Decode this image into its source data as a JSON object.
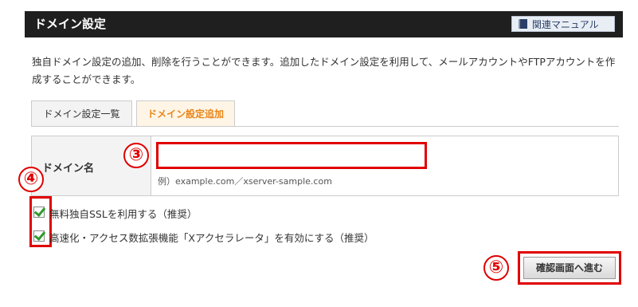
{
  "header": {
    "title": "ドメイン設定",
    "manual_button": "関連マニュアル"
  },
  "description": "独自ドメイン設定の追加、削除を行うことができます。追加したドメイン設定を利用して、メールアカウントやFTPアカウントを作成することができます。",
  "tabs": [
    {
      "label": "ドメイン設定一覧",
      "active": false
    },
    {
      "label": "ドメイン設定追加",
      "active": true
    }
  ],
  "form": {
    "domain_label": "ドメイン名",
    "domain_value": "",
    "domain_hint": "例）example.com／xserver-sample.com"
  },
  "options": [
    {
      "label": "無料独自SSLを利用する（推奨）",
      "checked": true
    },
    {
      "label": "高速化・アクセス数拡張機能「Xアクセラレータ」を有効にする（推奨）",
      "checked": true
    }
  ],
  "submit": {
    "label": "確認画面へ進む"
  },
  "annotations": {
    "n3": "③",
    "n4": "④",
    "n5": "⑤"
  },
  "colors": {
    "header_bg": "#1f1f1f",
    "active_tab": "#e8861a",
    "highlight": "#e00000",
    "check": "#2d9c2d"
  }
}
